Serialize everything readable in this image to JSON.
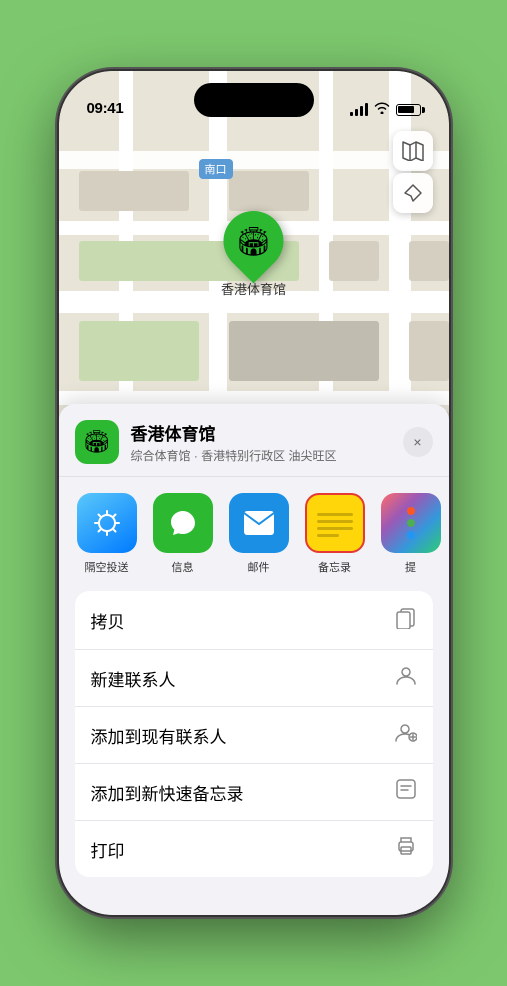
{
  "status_bar": {
    "time": "09:41",
    "location_arrow": "▶"
  },
  "map": {
    "label": "南口",
    "stadium_name": "香港体育馆"
  },
  "sheet": {
    "venue_name": "香港体育馆",
    "venue_desc": "综合体育馆 · 香港特别行政区 油尖旺区",
    "close_label": "×"
  },
  "share_items": [
    {
      "id": "airdrop",
      "label": "隔空投送",
      "type": "airdrop"
    },
    {
      "id": "messages",
      "label": "信息",
      "type": "messages"
    },
    {
      "id": "mail",
      "label": "邮件",
      "type": "mail"
    },
    {
      "id": "notes",
      "label": "备忘录",
      "type": "notes"
    },
    {
      "id": "more",
      "label": "提",
      "type": "more"
    }
  ],
  "actions": [
    {
      "label": "拷贝",
      "icon": "📋"
    },
    {
      "label": "新建联系人",
      "icon": "👤"
    },
    {
      "label": "添加到现有联系人",
      "icon": "👤"
    },
    {
      "label": "添加到新快速备忘录",
      "icon": "📝"
    },
    {
      "label": "打印",
      "icon": "🖨"
    }
  ]
}
